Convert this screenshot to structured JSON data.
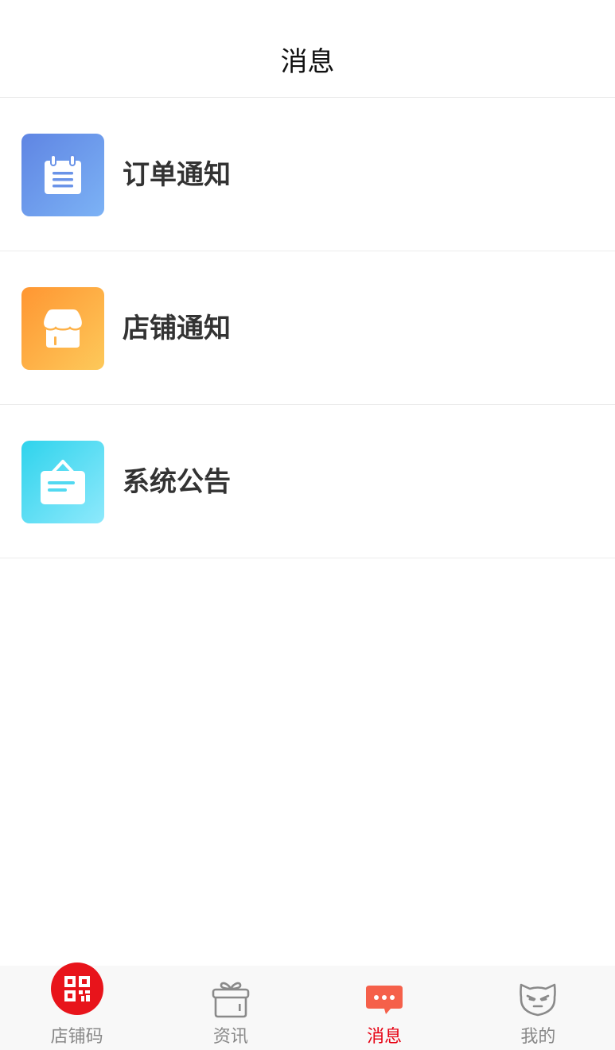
{
  "header": {
    "title": "消息"
  },
  "messages": {
    "items": [
      {
        "label": "订单通知",
        "icon": "clipboard-icon",
        "color_from": "#5f85e3",
        "color_to": "#7cb2f5"
      },
      {
        "label": "店铺通知",
        "icon": "shop-icon",
        "color_from": "#ff9632",
        "color_to": "#fdc95a"
      },
      {
        "label": "系统公告",
        "icon": "notice-board-icon",
        "color_from": "#2fd3ec",
        "color_to": "#8ee9fc"
      }
    ]
  },
  "tabbar": {
    "active_color": "#e60012",
    "inactive_color": "#888888",
    "items": [
      {
        "label": "店铺码",
        "icon": "qr-code-icon",
        "active": false
      },
      {
        "label": "资讯",
        "icon": "gift-icon",
        "active": false
      },
      {
        "label": "消息",
        "icon": "chat-bubble-icon",
        "active": true
      },
      {
        "label": "我的",
        "icon": "devil-face-icon",
        "active": false
      }
    ]
  }
}
